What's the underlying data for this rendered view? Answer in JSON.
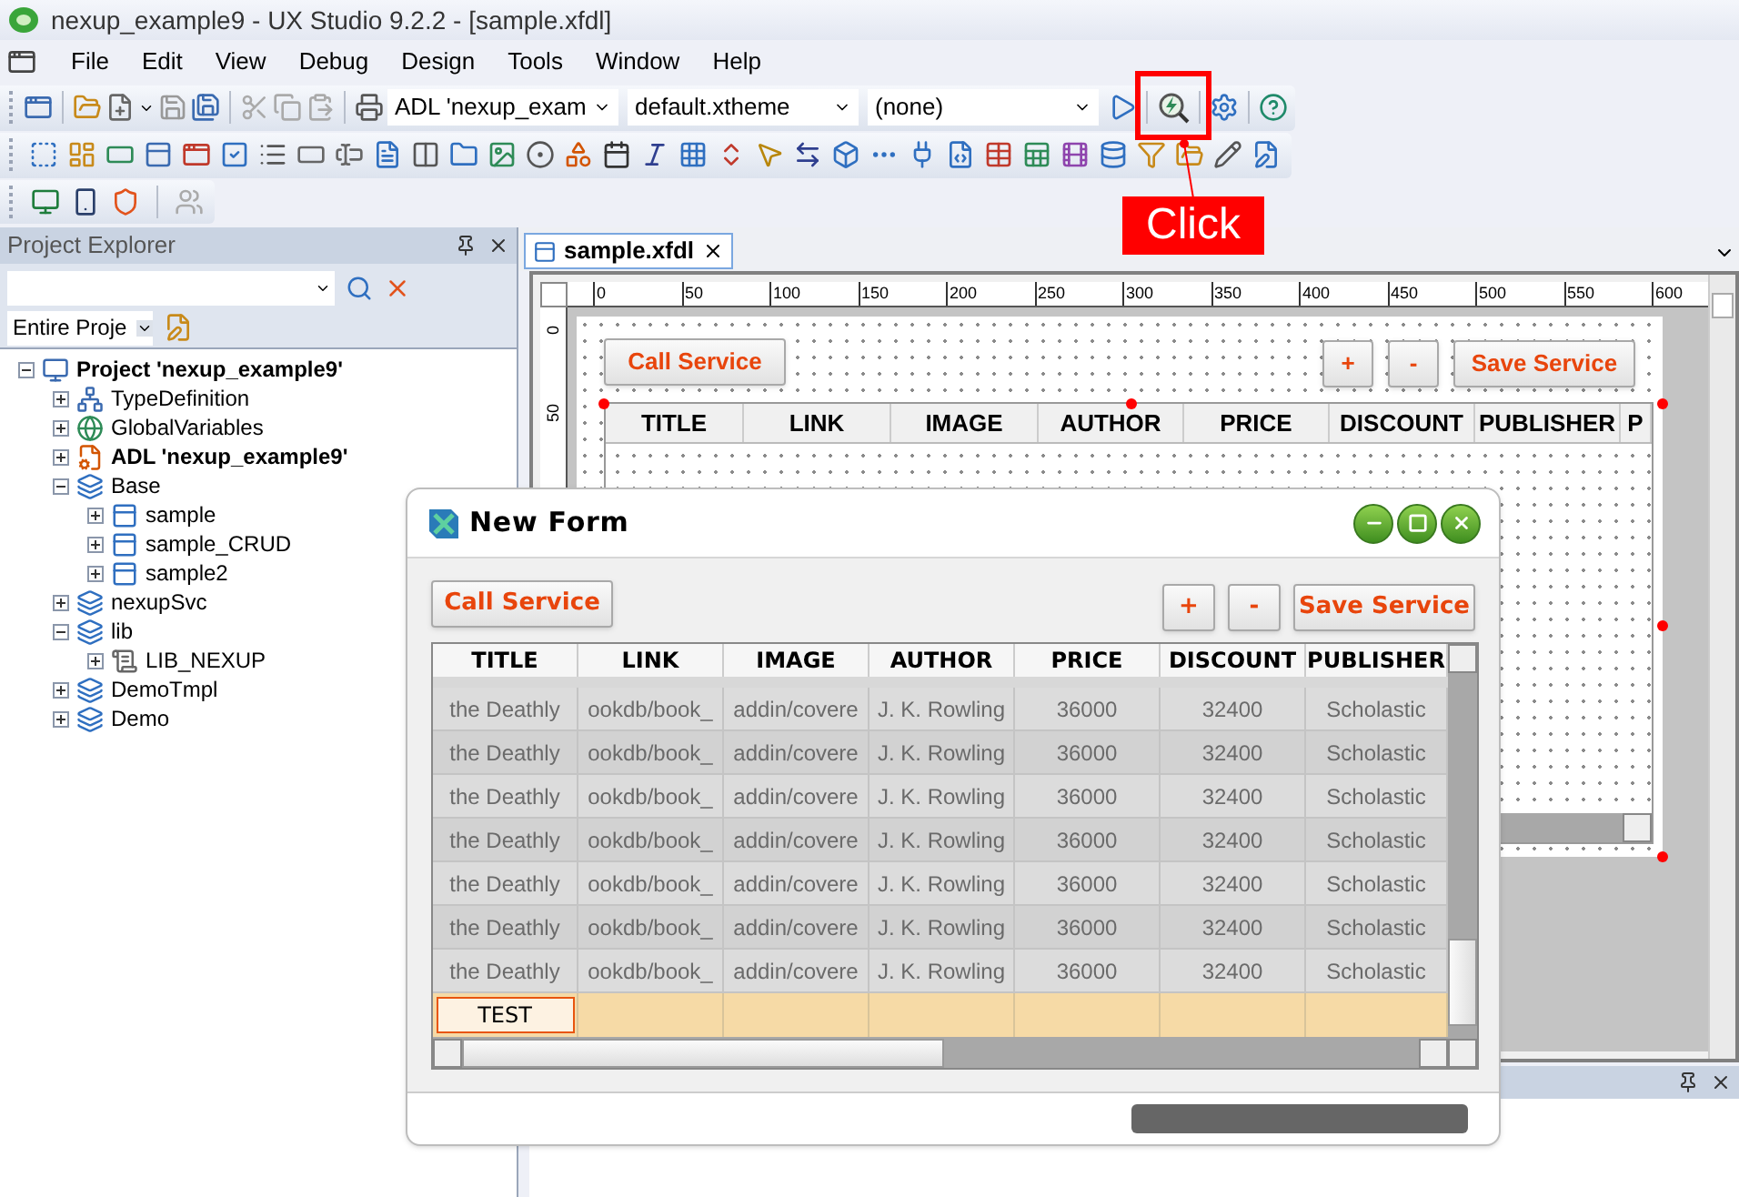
{
  "window": {
    "title": "nexup_example9 - UX Studio 9.2.2 - [sample.xfdl]"
  },
  "menu": [
    "File",
    "Edit",
    "View",
    "Debug",
    "Design",
    "Tools",
    "Window",
    "Help"
  ],
  "toolbar": {
    "combos": [
      {
        "value": "ADL 'nexup_exam"
      },
      {
        "value": "default.xtheme"
      },
      {
        "value": "(none)"
      }
    ]
  },
  "callout": {
    "label": "Click"
  },
  "project_explorer": {
    "title": "Project Explorer",
    "scope": "Entire Proje",
    "tree": [
      {
        "label": "Project 'nexup_example9'",
        "kind": "project",
        "bold": true,
        "expanded": true,
        "children": [
          {
            "label": "TypeDefinition",
            "kind": "typedef",
            "bold": false,
            "expanded": false
          },
          {
            "label": "GlobalVariables",
            "kind": "variables",
            "bold": false,
            "expanded": false
          },
          {
            "label": "ADL 'nexup_example9'",
            "kind": "adl",
            "bold": true,
            "expanded": false
          },
          {
            "label": "Base",
            "kind": "service",
            "bold": false,
            "expanded": true,
            "children": [
              {
                "label": "sample",
                "kind": "form",
                "bold": false,
                "expanded": false
              },
              {
                "label": "sample_CRUD",
                "kind": "form",
                "bold": false,
                "expanded": false
              },
              {
                "label": "sample2",
                "kind": "form",
                "bold": false,
                "expanded": false
              }
            ]
          },
          {
            "label": "nexupSvc",
            "kind": "service",
            "bold": false,
            "expanded": false
          },
          {
            "label": "lib",
            "kind": "service",
            "bold": false,
            "expanded": true,
            "children": [
              {
                "label": "LIB_NEXUP",
                "kind": "library",
                "bold": false,
                "expanded": false
              }
            ]
          },
          {
            "label": "DemoTmpl",
            "kind": "service",
            "bold": false,
            "expanded": false
          },
          {
            "label": "Demo",
            "kind": "service",
            "bold": false,
            "expanded": false
          }
        ]
      }
    ]
  },
  "editor": {
    "tab": "sample.xfdl",
    "ruler": [
      "0",
      "50",
      "100",
      "150",
      "200",
      "250",
      "300",
      "350",
      "400",
      "450",
      "500",
      "550",
      "600"
    ],
    "vruler": [
      "0",
      "50"
    ],
    "buttons": {
      "call": "Call Service",
      "plus": "+",
      "minus": "-",
      "save": "Save Service"
    },
    "columns": [
      "TITLE",
      "LINK",
      "IMAGE",
      "AUTHOR",
      "PRICE",
      "DISCOUNT",
      "PUBLISHER",
      "P"
    ]
  },
  "form": {
    "title": "New Form",
    "buttons": {
      "call": "Call Service",
      "plus": "+",
      "minus": "-",
      "save": "Save Service"
    },
    "columns": [
      "TITLE",
      "LINK",
      "IMAGE",
      "AUTHOR",
      "PRICE",
      "DISCOUNT",
      "PUBLISHER"
    ],
    "rows": [
      {
        "cells": [
          "the Deathly",
          "ookdb/book_",
          "addin/covere",
          "J. K. Rowling",
          "36000",
          "32400",
          "Scholastic"
        ]
      },
      {
        "cells": [
          "the Deathly",
          "ookdb/book_",
          "addin/covere",
          "J. K. Rowling",
          "36000",
          "32400",
          "Scholastic"
        ]
      },
      {
        "cells": [
          "the Deathly",
          "ookdb/book_",
          "addin/covere",
          "J. K. Rowling",
          "36000",
          "32400",
          "Scholastic"
        ]
      },
      {
        "cells": [
          "the Deathly",
          "ookdb/book_",
          "addin/covere",
          "J. K. Rowling",
          "36000",
          "32400",
          "Scholastic"
        ]
      },
      {
        "cells": [
          "the Deathly",
          "ookdb/book_",
          "addin/covere",
          "J. K. Rowling",
          "36000",
          "32400",
          "Scholastic"
        ]
      },
      {
        "cells": [
          "the Deathly",
          "ookdb/book_",
          "addin/covere",
          "J. K. Rowling",
          "36000",
          "32400",
          "Scholastic"
        ]
      },
      {
        "cells": [
          "the Deathly",
          "ookdb/book_",
          "addin/covere",
          "J. K. Rowling",
          "36000",
          "32400",
          "Scholastic"
        ]
      }
    ],
    "edit_row": {
      "value": "TEST"
    }
  }
}
